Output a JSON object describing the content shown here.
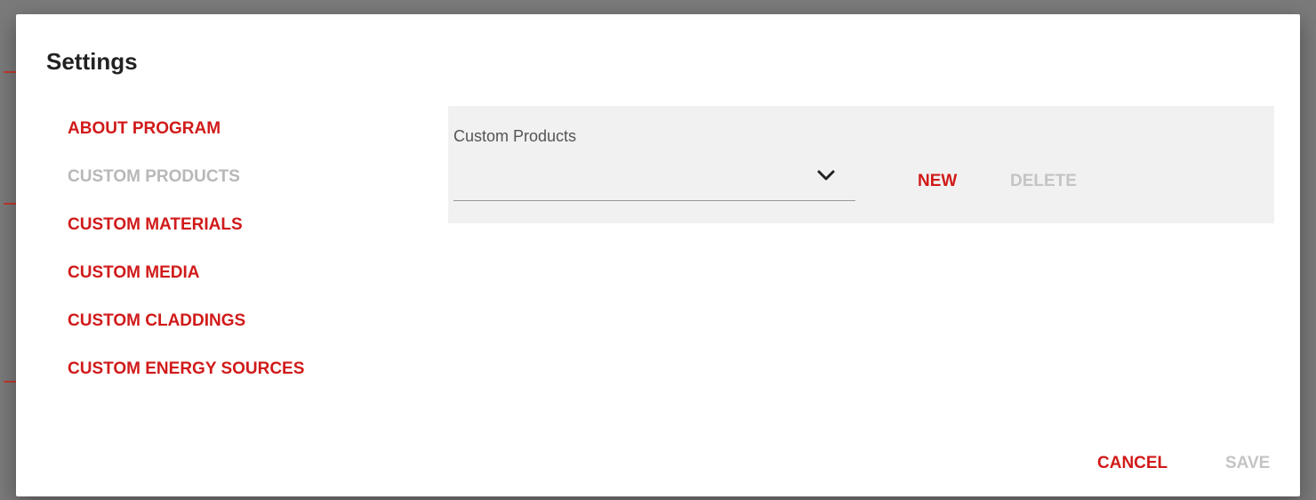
{
  "dialog": {
    "title": "Settings"
  },
  "nav": {
    "items": [
      {
        "label": "ABOUT PROGRAM",
        "active": false
      },
      {
        "label": "CUSTOM PRODUCTS",
        "active": true
      },
      {
        "label": "CUSTOM MATERIALS",
        "active": false
      },
      {
        "label": "CUSTOM MEDIA",
        "active": false
      },
      {
        "label": "CUSTOM CLADDINGS",
        "active": false
      },
      {
        "label": "CUSTOM ENERGY SOURCES",
        "active": false
      }
    ]
  },
  "panel": {
    "select_label": "Custom Products",
    "select_value": "",
    "new_label": "NEW",
    "delete_label": "DELETE"
  },
  "footer": {
    "cancel_label": "CANCEL",
    "save_label": "SAVE"
  },
  "colors": {
    "accent": "#d11a1a",
    "disabled": "#c4c4c4",
    "panel_bg": "#f1f1f1",
    "backdrop": "#7a7a7a"
  }
}
